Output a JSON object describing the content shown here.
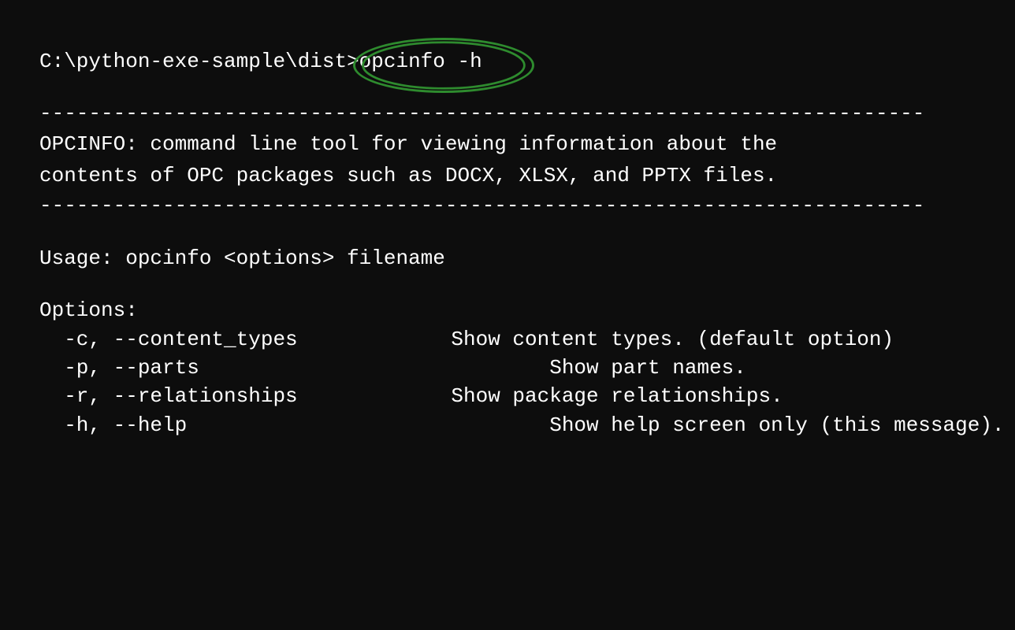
{
  "terminal": {
    "prompt": "C:\\python-exe-sample\\dist>",
    "command": "opcinfo -h",
    "separator": "------------------------------------------------------------------------",
    "description_line1": "OPCINFO: command line tool for viewing information about the",
    "description_line2": "contents of OPC packages such as DOCX, XLSX, and PPTX files.",
    "usage": "Usage: opcinfo <options> filename",
    "options_header": "Options:",
    "options": [
      {
        "flag": "  -c, --content_types",
        "desc": "    Show content types. (default option)"
      },
      {
        "flag": "  -p, --parts",
        "desc": "            Show part names."
      },
      {
        "flag": "  -r, --relationships",
        "desc": "    Show package relationships."
      },
      {
        "flag": "  -h, --help",
        "desc": "            Show help screen only (this message)."
      }
    ]
  }
}
